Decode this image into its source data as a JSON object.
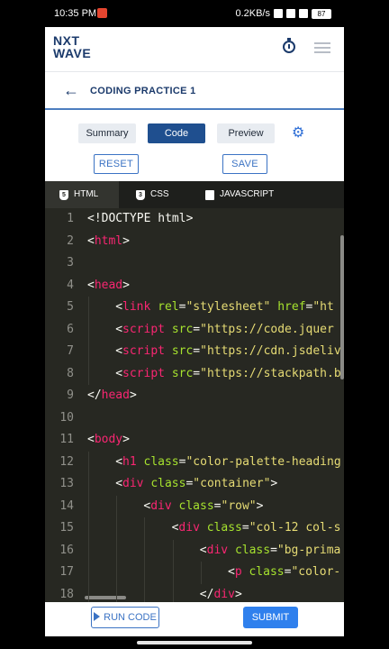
{
  "status_bar": {
    "time": "10:35 PM",
    "speed": "0.2KB/s",
    "battery": "87"
  },
  "header": {
    "logo_line1": "NXT",
    "logo_line2": "WAVE"
  },
  "title_bar": {
    "title": "CODING PRACTICE 1"
  },
  "view_tabs": [
    "Summary",
    "Code",
    "Preview"
  ],
  "actions": {
    "reset": "RESET",
    "save": "SAVE"
  },
  "file_tabs": [
    {
      "label": "HTML",
      "icon": "html5-icon"
    },
    {
      "label": "CSS",
      "icon": "css3-icon"
    },
    {
      "label": "JAVASCRIPT",
      "icon": "js-icon"
    }
  ],
  "code_lines": [
    {
      "n": "1",
      "indent": 0,
      "tokens": [
        [
          "plain",
          "<!DOCTYPE html>"
        ]
      ]
    },
    {
      "n": "2",
      "indent": 0,
      "tokens": [
        [
          "plain",
          "<"
        ],
        [
          "tag",
          "html"
        ],
        [
          "plain",
          ">"
        ]
      ]
    },
    {
      "n": "3",
      "indent": 0,
      "tokens": []
    },
    {
      "n": "4",
      "indent": 0,
      "tokens": [
        [
          "plain",
          "<"
        ],
        [
          "tag",
          "head"
        ],
        [
          "plain",
          ">"
        ]
      ]
    },
    {
      "n": "5",
      "indent": 1,
      "tokens": [
        [
          "plain",
          "<"
        ],
        [
          "tag",
          "link"
        ],
        [
          "plain",
          " "
        ],
        [
          "attr",
          "rel"
        ],
        [
          "plain",
          "="
        ],
        [
          "str",
          "\"stylesheet\""
        ],
        [
          "plain",
          " "
        ],
        [
          "attr",
          "href"
        ],
        [
          "plain",
          "="
        ],
        [
          "str",
          "\"ht"
        ]
      ]
    },
    {
      "n": "6",
      "indent": 1,
      "tokens": [
        [
          "plain",
          "<"
        ],
        [
          "tag",
          "script"
        ],
        [
          "plain",
          " "
        ],
        [
          "attr",
          "src"
        ],
        [
          "plain",
          "="
        ],
        [
          "str",
          "\"https://code.jquer"
        ]
      ]
    },
    {
      "n": "7",
      "indent": 1,
      "tokens": [
        [
          "plain",
          "<"
        ],
        [
          "tag",
          "script"
        ],
        [
          "plain",
          " "
        ],
        [
          "attr",
          "src"
        ],
        [
          "plain",
          "="
        ],
        [
          "str",
          "\"https://cdn.jsdeliv"
        ]
      ]
    },
    {
      "n": "8",
      "indent": 1,
      "tokens": [
        [
          "plain",
          "<"
        ],
        [
          "tag",
          "script"
        ],
        [
          "plain",
          " "
        ],
        [
          "attr",
          "src"
        ],
        [
          "plain",
          "="
        ],
        [
          "str",
          "\"https://stackpath.b"
        ]
      ]
    },
    {
      "n": "9",
      "indent": 0,
      "tokens": [
        [
          "plain",
          "</"
        ],
        [
          "tag",
          "head"
        ],
        [
          "plain",
          ">"
        ]
      ]
    },
    {
      "n": "10",
      "indent": 0,
      "tokens": []
    },
    {
      "n": "11",
      "indent": 0,
      "tokens": [
        [
          "plain",
          "<"
        ],
        [
          "tag",
          "body"
        ],
        [
          "plain",
          ">"
        ]
      ]
    },
    {
      "n": "12",
      "indent": 1,
      "tokens": [
        [
          "plain",
          "<"
        ],
        [
          "tag",
          "h1"
        ],
        [
          "plain",
          " "
        ],
        [
          "attr",
          "class"
        ],
        [
          "plain",
          "="
        ],
        [
          "str",
          "\"color-palette-heading"
        ]
      ]
    },
    {
      "n": "13",
      "indent": 1,
      "tokens": [
        [
          "plain",
          "<"
        ],
        [
          "tag",
          "div"
        ],
        [
          "plain",
          " "
        ],
        [
          "attr",
          "class"
        ],
        [
          "plain",
          "="
        ],
        [
          "str",
          "\"container\""
        ],
        [
          "plain",
          ">"
        ]
      ]
    },
    {
      "n": "14",
      "indent": 2,
      "tokens": [
        [
          "plain",
          "<"
        ],
        [
          "tag",
          "div"
        ],
        [
          "plain",
          " "
        ],
        [
          "attr",
          "class"
        ],
        [
          "plain",
          "="
        ],
        [
          "str",
          "\"row\""
        ],
        [
          "plain",
          ">"
        ]
      ]
    },
    {
      "n": "15",
      "indent": 3,
      "tokens": [
        [
          "plain",
          "<"
        ],
        [
          "tag",
          "div"
        ],
        [
          "plain",
          " "
        ],
        [
          "attr",
          "class"
        ],
        [
          "plain",
          "="
        ],
        [
          "str",
          "\"col-12 col-s"
        ]
      ]
    },
    {
      "n": "16",
      "indent": 4,
      "tokens": [
        [
          "plain",
          "<"
        ],
        [
          "tag",
          "div"
        ],
        [
          "plain",
          " "
        ],
        [
          "attr",
          "class"
        ],
        [
          "plain",
          "="
        ],
        [
          "str",
          "\"bg-prima"
        ]
      ]
    },
    {
      "n": "17",
      "indent": 5,
      "tokens": [
        [
          "plain",
          "<"
        ],
        [
          "tag",
          "p"
        ],
        [
          "plain",
          " "
        ],
        [
          "attr",
          "class"
        ],
        [
          "plain",
          "="
        ],
        [
          "str",
          "\"color-"
        ]
      ]
    },
    {
      "n": "18",
      "indent": 4,
      "tokens": [
        [
          "plain",
          "</"
        ],
        [
          "tag",
          "div"
        ],
        [
          "plain",
          ">"
        ]
      ]
    }
  ],
  "footer": {
    "run": "RUN CODE",
    "submit": "SUBMIT"
  }
}
